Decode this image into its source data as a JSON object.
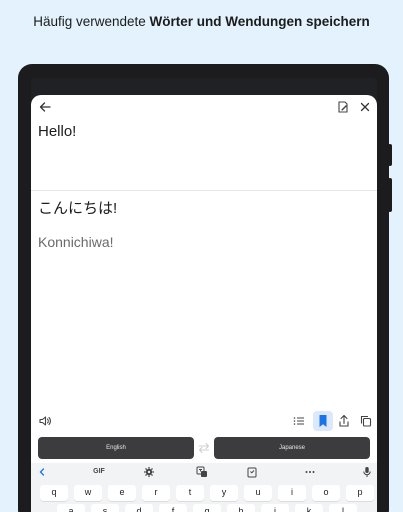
{
  "headline": {
    "normal": "Häufig verwendete ",
    "bold": "Wörter und Wendungen speichern"
  },
  "translator": {
    "source_text": "Hello!",
    "target_text": "こんにちは!",
    "romanization": "Konnichiwa!",
    "icons": {
      "back": "arrow-left-icon",
      "edit": "edit-icon",
      "close": "close-icon",
      "speaker": "speaker-icon",
      "list": "list-icon",
      "bookmark": "bookmark-icon",
      "share": "share-icon",
      "copy": "copy-icon"
    },
    "bookmark_active_color": "#1a73e8"
  },
  "language_bar": {
    "source": "English",
    "target": "Japanese",
    "swap_icon": "swap-icon"
  },
  "keyboard": {
    "toolbar": {
      "gif_label": "GIF",
      "icons": [
        "chevron-left-icon",
        "gif-icon",
        "gear-icon",
        "translate-icon",
        "clipboard-icon",
        "more-icon",
        "mic-icon"
      ]
    },
    "row1": [
      "q",
      "w",
      "e",
      "r",
      "t",
      "y",
      "u",
      "i",
      "o",
      "p"
    ],
    "row2": [
      "a",
      "s",
      "d",
      "f",
      "g",
      "h",
      "j",
      "k",
      "l"
    ]
  }
}
